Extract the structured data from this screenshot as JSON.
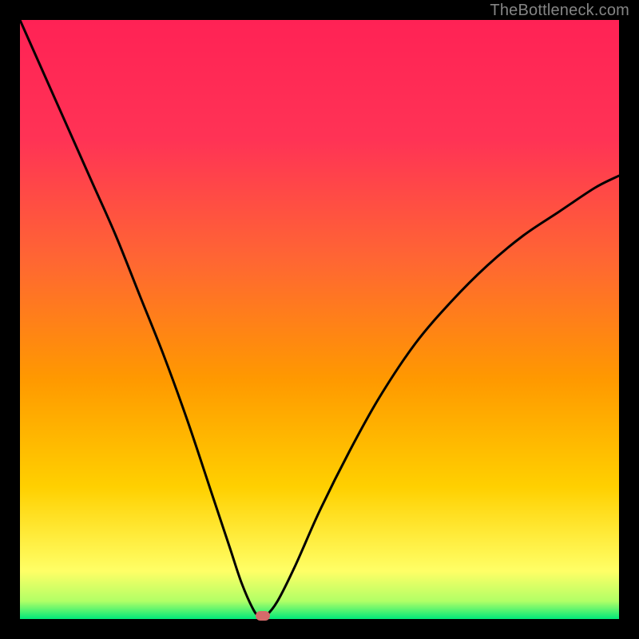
{
  "watermark": "TheBottleneck.com",
  "chart_data": {
    "type": "line",
    "title": "",
    "xlabel": "",
    "ylabel": "",
    "xlim": [
      0,
      100
    ],
    "ylim": [
      0,
      100
    ],
    "grid": false,
    "legend": false,
    "marker": {
      "x": 40.5,
      "y": 0.5
    },
    "series": [
      {
        "name": "curve",
        "x": [
          0,
          4,
          8,
          12,
          16,
          20,
          24,
          28,
          32,
          35,
          37,
          39,
          40,
          41,
          43,
          46,
          50,
          55,
          60,
          66,
          72,
          78,
          84,
          90,
          96,
          100
        ],
        "y": [
          100,
          91,
          82,
          73,
          64,
          54,
          44,
          33,
          21,
          12,
          6,
          1.5,
          0.5,
          0.5,
          3,
          9,
          18,
          28,
          37,
          46,
          53,
          59,
          64,
          68,
          72,
          74
        ]
      }
    ],
    "background_gradient_vertical": {
      "stops": [
        {
          "pos": 0,
          "color": "#00e87a"
        },
        {
          "pos": 3,
          "color": "#b2ff66"
        },
        {
          "pos": 8,
          "color": "#ffff66"
        },
        {
          "pos": 22,
          "color": "#ffd000"
        },
        {
          "pos": 40,
          "color": "#ff9900"
        },
        {
          "pos": 60,
          "color": "#ff6633"
        },
        {
          "pos": 80,
          "color": "#ff3355"
        },
        {
          "pos": 100,
          "color": "#ff2255"
        }
      ]
    }
  }
}
